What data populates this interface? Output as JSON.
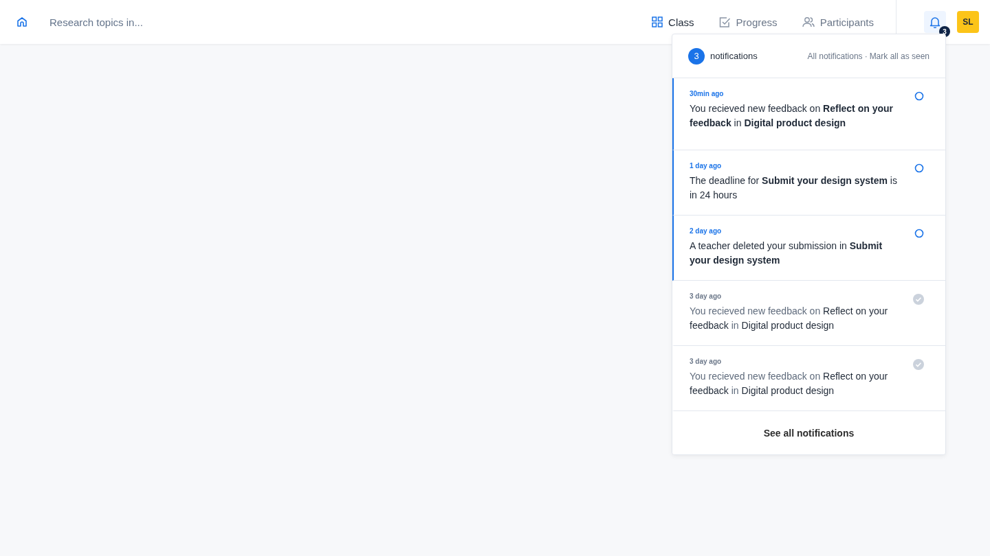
{
  "header": {
    "title": "Research topics in...",
    "tabs": [
      {
        "label": "Class",
        "kind": "grid",
        "selected": true
      },
      {
        "label": "Progress",
        "kind": "check",
        "selected": false
      },
      {
        "label": "Participants",
        "kind": "people",
        "selected": false
      }
    ],
    "bell_badge": "3",
    "avatar": "SL"
  },
  "notifications_panel": {
    "count": "3",
    "title": "notifications",
    "links": [
      "All notifications",
      "Mark all as seen"
    ],
    "separator": "·",
    "items": [
      {
        "time": "30min ago",
        "text": "You recieved new feedback on **Reflect on your feedback** in **Digital product design**",
        "seen": false
      },
      {
        "time": "1 day ago",
        "text": "The deadline for **Submit your design system** is in 24 hours",
        "seen": false
      },
      {
        "time": "2 day ago",
        "text": "A teacher deleted your submission in **Submit your design system**",
        "seen": false
      },
      {
        "time": "3 day ago",
        "text": "You recieved new feedback on **Reflect on your feedback** in **Digital product design**",
        "seen": true
      },
      {
        "time": "3 day ago",
        "text": "You recieved new feedback on **Reflect on your feedback** in **Digital product design**",
        "seen": true
      }
    ],
    "footer": "See all notifications"
  }
}
